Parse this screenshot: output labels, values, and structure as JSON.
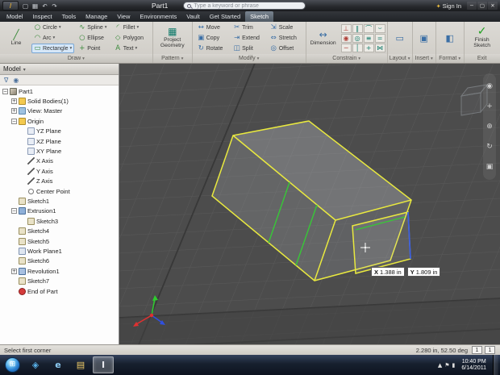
{
  "title_bar": {
    "app_glyph": "I",
    "qat": [
      {
        "name": "new-button",
        "glyph": "▢"
      },
      {
        "name": "save-button",
        "glyph": "▦"
      },
      {
        "name": "undo-button",
        "glyph": "↶"
      },
      {
        "name": "redo-button",
        "glyph": "↷"
      }
    ],
    "title": "Part1",
    "search_placeholder": "Type a keyword or phrase",
    "sign_in_label": "Sign In",
    "window_buttons": [
      {
        "name": "minimize-button",
        "glyph": "─"
      },
      {
        "name": "restore-button",
        "glyph": "▢"
      },
      {
        "name": "close-button",
        "glyph": "✕"
      }
    ]
  },
  "tabs": [
    {
      "label": "Model"
    },
    {
      "label": "Inspect"
    },
    {
      "label": "Tools"
    },
    {
      "label": "Manage"
    },
    {
      "label": "View"
    },
    {
      "label": "Environments"
    },
    {
      "label": "Vault"
    },
    {
      "label": "Get Started"
    },
    {
      "label": "Sketch",
      "active": true
    }
  ],
  "ribbon": {
    "draw": {
      "line_label": "Line",
      "line_icon": "╱",
      "buttons": [
        {
          "label": "Circle",
          "glyph": "○",
          "arrow": true
        },
        {
          "label": "Spline",
          "glyph": "∿",
          "arrow": true
        },
        {
          "label": "Fillet",
          "glyph": "◜",
          "arrow": true
        },
        {
          "label": "Arc",
          "glyph": "◠",
          "arrow": true
        },
        {
          "label": "Ellipse",
          "glyph": "○"
        },
        {
          "label": "Polygon",
          "glyph": "◇"
        },
        {
          "label": "Rectangle",
          "glyph": "▭",
          "arrow": true,
          "active": true
        },
        {
          "label": "Point",
          "glyph": "+"
        },
        {
          "label": "Text",
          "glyph": "A",
          "arrow": true
        }
      ],
      "panel_label": "Draw"
    },
    "pattern": {
      "button_label": "Project Geometry",
      "icon": "▦",
      "panel_label": "Pattern"
    },
    "modify": {
      "buttons": [
        {
          "label": "Move",
          "glyph": "↔"
        },
        {
          "label": "Trim",
          "glyph": "✂"
        },
        {
          "label": "Scale",
          "glyph": "⇲"
        },
        {
          "label": "Copy",
          "glyph": "▣"
        },
        {
          "label": "Extend",
          "glyph": "⇥"
        },
        {
          "label": "Stretch",
          "glyph": "⇔"
        },
        {
          "label": "Rotate",
          "glyph": "↻"
        },
        {
          "label": "Split",
          "glyph": "◫"
        },
        {
          "label": "Offset",
          "glyph": "◎"
        }
      ],
      "panel_label": "Modify"
    },
    "constrain": {
      "dimension_label": "Dimension",
      "dimension_icon": "↔",
      "icons": [
        {
          "name": "perpendicular-icon",
          "glyph": "⊥"
        },
        {
          "name": "parallel-icon",
          "glyph": "∥"
        },
        {
          "name": "tangent-icon",
          "glyph": "⌒"
        },
        {
          "name": "smooth-icon",
          "glyph": "⌣"
        },
        {
          "name": "coincident-icon",
          "glyph": "◉"
        },
        {
          "name": "concentric-icon",
          "glyph": "◎"
        },
        {
          "name": "collinear-icon",
          "glyph": "≡"
        },
        {
          "name": "equal-icon",
          "glyph": "="
        },
        {
          "name": "horizontal-icon",
          "glyph": "─"
        },
        {
          "name": "vertical-icon",
          "glyph": "│"
        },
        {
          "name": "fix-icon",
          "glyph": "+"
        },
        {
          "name": "symmetric-icon",
          "glyph": "⋈"
        }
      ],
      "panel_label": "Constrain"
    },
    "layout": {
      "icon": "▭",
      "panel_label": "Layout"
    },
    "insert": {
      "icon": "▣",
      "panel_label": "Insert"
    },
    "format": {
      "icon": "◧",
      "panel_label": "Format"
    },
    "exit": {
      "button_label": "Finish Sketch",
      "icon": "✓",
      "panel_label": "Exit"
    }
  },
  "browser": {
    "header_label": "Model",
    "tree": [
      {
        "label": "Part1",
        "level": 0,
        "icon": "part",
        "expander": "minus"
      },
      {
        "label": "Solid Bodies(1)",
        "level": 1,
        "icon": "folder",
        "expander": "plus"
      },
      {
        "label": "View: Master",
        "level": 1,
        "icon": "view",
        "expander": "plus"
      },
      {
        "label": "Origin",
        "level": 1,
        "icon": "folder",
        "expander": "minus"
      },
      {
        "label": "YZ Plane",
        "level": 2,
        "icon": "plane"
      },
      {
        "label": "XZ Plane",
        "level": 2,
        "icon": "plane"
      },
      {
        "label": "XY Plane",
        "level": 2,
        "icon": "plane"
      },
      {
        "label": "X Axis",
        "level": 2,
        "icon": "axis"
      },
      {
        "label": "Y Axis",
        "level": 2,
        "icon": "axis"
      },
      {
        "label": "Z Axis",
        "level": 2,
        "icon": "axis"
      },
      {
        "label": "Center Point",
        "level": 2,
        "icon": "point"
      },
      {
        "label": "Sketch1",
        "level": 1,
        "icon": "sketch"
      },
      {
        "label": "Extrusion1",
        "level": 1,
        "icon": "extrusion",
        "expander": "minus"
      },
      {
        "label": "Sketch3",
        "level": 2,
        "icon": "sketch"
      },
      {
        "label": "Sketch4",
        "level": 1,
        "icon": "sketch"
      },
      {
        "label": "Sketch5",
        "level": 1,
        "icon": "sketch"
      },
      {
        "label": "Work Plane1",
        "level": 1,
        "icon": "workplane"
      },
      {
        "label": "Sketch6",
        "level": 1,
        "icon": "sketch"
      },
      {
        "label": "Revolution1",
        "level": 1,
        "icon": "revolution",
        "expander": "plus"
      },
      {
        "label": "Sketch7",
        "level": 1,
        "icon": "sketch"
      },
      {
        "label": "End of Part",
        "level": 1,
        "icon": "endofpart"
      }
    ]
  },
  "viewport": {
    "coord_x_label": "X",
    "coord_x_value": "1.388 in",
    "coord_y_label": "Y",
    "coord_y_value": "1.809 in",
    "nav_icons": [
      {
        "name": "steering-wheel-icon",
        "glyph": "◉"
      },
      {
        "name": "pan-icon",
        "glyph": "+"
      },
      {
        "name": "zoom-icon",
        "glyph": "⊕"
      },
      {
        "name": "orbit-icon",
        "glyph": "↻"
      },
      {
        "name": "look-at-icon",
        "glyph": "▣"
      }
    ],
    "colors": {
      "edge_highlight": "#e9e93f",
      "section_line": "#37c837",
      "selected_edge": "#3c5fe0"
    }
  },
  "status_bar": {
    "message": "Select first corner",
    "readout": "2.280 in, 52.50 deg",
    "counter1": "1",
    "counter2": "1"
  },
  "taskbar": {
    "apps": [
      {
        "name": "media-player",
        "glyph": "◈",
        "color": "#58b0e8"
      },
      {
        "name": "internet-explorer",
        "glyph": "e",
        "color": "#8ecdf5"
      },
      {
        "name": "explorer",
        "glyph": "▤",
        "color": "#f4d06a"
      },
      {
        "name": "inventor",
        "glyph": "I",
        "color": "#e8e8ee",
        "active": true
      }
    ],
    "tray_icons": [
      {
        "name": "show-hidden-icon",
        "glyph": "▲"
      },
      {
        "name": "action-center-icon",
        "glyph": "⚑"
      },
      {
        "name": "network-icon",
        "glyph": "▮"
      }
    ],
    "time": "10:40 PM",
    "date": "6/14/2011"
  }
}
